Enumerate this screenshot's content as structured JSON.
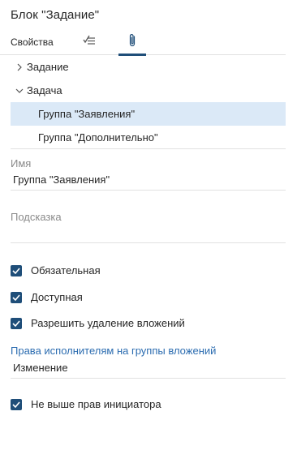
{
  "title": "Блок \"Задание\"",
  "tabs": {
    "properties_label": "Свойства",
    "icons": [
      "checklist-edit-icon",
      "paperclip-icon"
    ],
    "active": "paperclip"
  },
  "tree": {
    "items": [
      {
        "label": "Задание",
        "expanded": false
      },
      {
        "label": "Задача",
        "expanded": true
      },
      {
        "label": "Группа \"Заявления\"",
        "selected": true
      },
      {
        "label": "Группа \"Дополнительно\"",
        "selected": false
      }
    ]
  },
  "name_field": {
    "label": "Имя",
    "value": "Группа \"Заявления\""
  },
  "hint_field": {
    "label": "Подсказка",
    "value": ""
  },
  "checkboxes": [
    {
      "label": "Обязательная",
      "checked": true
    },
    {
      "label": "Доступная",
      "checked": true
    },
    {
      "label": "Разрешить удаление вложений",
      "checked": true
    }
  ],
  "rights": {
    "label": "Права исполнителям на группы вложений",
    "value": "Изменение"
  },
  "initiator_checkbox": {
    "label": "Не выше прав инициатора",
    "checked": true
  },
  "colors": {
    "accent": "#1f4e79",
    "selection": "#dbe9f7",
    "link": "#2b6cb0"
  }
}
